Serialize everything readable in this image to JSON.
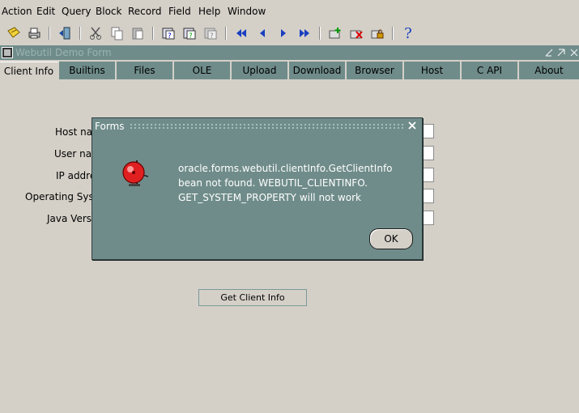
{
  "menubar": {
    "items": [
      {
        "label": "Action"
      },
      {
        "label": "Edit"
      },
      {
        "label": "Query"
      },
      {
        "label": "Block"
      },
      {
        "label": "Record"
      },
      {
        "label": "Field"
      },
      {
        "label": "Help"
      },
      {
        "label": "Window"
      }
    ]
  },
  "window": {
    "title": "Webutil Demo Form"
  },
  "tabs": [
    {
      "label": "Client Info",
      "active": true
    },
    {
      "label": "Builtins"
    },
    {
      "label": "Files"
    },
    {
      "label": "OLE"
    },
    {
      "label": "Upload"
    },
    {
      "label": "Download"
    },
    {
      "label": "Browser"
    },
    {
      "label": "Host"
    },
    {
      "label": "C API"
    },
    {
      "label": "About"
    }
  ],
  "form": {
    "labels": [
      "Host nam",
      "User nam",
      "IP addre",
      "Operating Syste",
      "Java Vers"
    ],
    "button_label": "Get Client Info"
  },
  "dialog": {
    "title": "Forms",
    "message": "oracle.forms.webutil.clientInfo.GetClientInfo bean not found. WEBUTIL_CLIENTINFO. GET_SYSTEM_PROPERTY will not work",
    "ok_label": "OK"
  },
  "toolbar": {
    "help_glyph": "?"
  },
  "colors": {
    "panel": "#d4d0c8",
    "teal": "#6f8c8a"
  }
}
